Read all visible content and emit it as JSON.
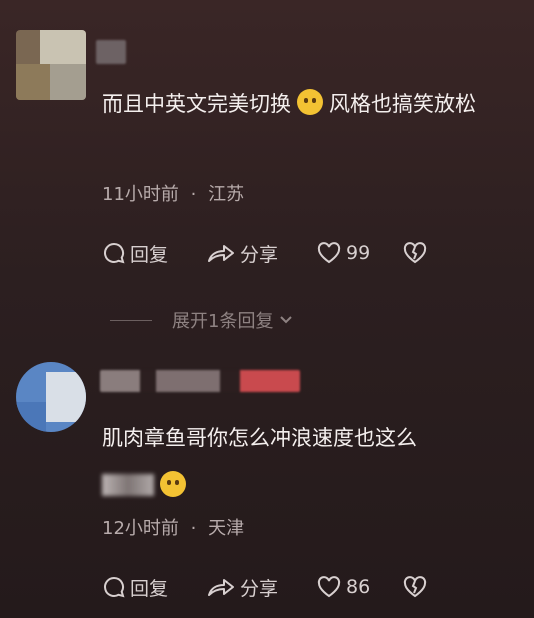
{
  "comments": [
    {
      "text_before": "而且中英文完美切换",
      "emoji": "worried-face-emoji",
      "text_after": "风格也搞笑放松",
      "time": "11小时前",
      "location": "江苏",
      "reply_label": "回复",
      "share_label": "分享",
      "likes": "99"
    },
    {
      "text_before": "肌肉章鱼哥你怎么冲浪速度也这么",
      "emoji": "laughing-tears-emoji",
      "text_after": "",
      "time": "12小时前",
      "location": "天津",
      "reply_label": "回复",
      "share_label": "分享",
      "likes": "86"
    }
  ],
  "expand_replies": "展开1条回复",
  "separator": "·",
  "colors": {
    "background": "#2c1f20",
    "text": "#f4efee",
    "meta": "#b7abab",
    "emoji": "#f3c233"
  }
}
